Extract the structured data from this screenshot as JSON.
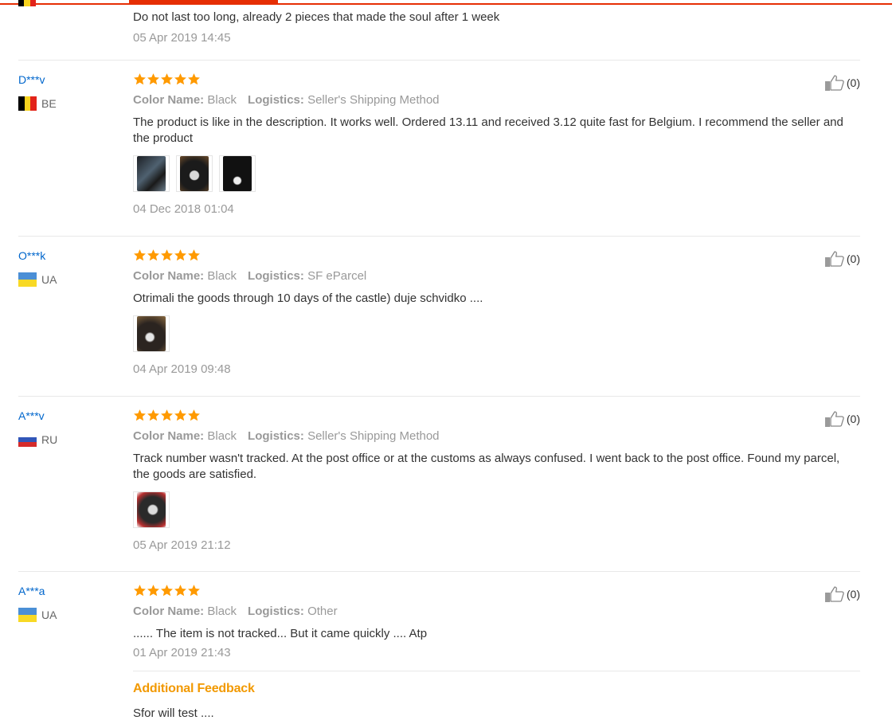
{
  "previous_review": {
    "text": "Do not last too long, already 2 pieces that made the soul after 1 week",
    "date": "05 Apr 2019 14:45"
  },
  "labels": {
    "color_name": "Color Name:",
    "logistics": "Logistics:"
  },
  "reviews": [
    {
      "user": "D***v",
      "country": "BE",
      "flag_colors": [
        "#000000",
        "#f7d21e",
        "#e2231a"
      ],
      "rating": 5,
      "color": "Black",
      "logistics": "Seller's Shipping Method",
      "text": "The product is like in the description. It works well. Ordered 13.11 and received 3.12 quite fast for Belgium. I recommend the seller and the product",
      "photo_count": 3,
      "date": "04 Dec 2018 01:04",
      "helpful": "(0)"
    },
    {
      "user": "O***k",
      "country": "UA",
      "flag_colors": [
        "#4b8fd6",
        "#f8d925"
      ],
      "rating": 5,
      "color": "Black",
      "logistics": "SF eParcel",
      "text": "Otrimali the goods through 10 days of the castle) duje schvidko ....",
      "photo_count": 1,
      "date": "04 Apr 2019 09:48",
      "helpful": "(0)"
    },
    {
      "user": "A***v",
      "country": "RU",
      "flag_colors": [
        "#ffffff",
        "#3156b8",
        "#d52b2b"
      ],
      "rating": 5,
      "color": "Black",
      "logistics": "Seller's Shipping Method",
      "text": "Track number wasn't tracked. At the post office or at the customs as always confused. I went back to the post office. Found my parcel, the goods are satisfied.",
      "photo_count": 1,
      "date": "05 Apr 2019 21:12",
      "helpful": "(0)"
    },
    {
      "user": "A***a",
      "country": "UA",
      "flag_colors": [
        "#4b8fd6",
        "#f8d925"
      ],
      "rating": 5,
      "color": "Black",
      "logistics": "Other",
      "text": "...... The item is not tracked... But it came quickly .... Atp",
      "photo_count": 0,
      "date": "01 Apr 2019 21:43",
      "helpful": "(0)",
      "additional_feedback": {
        "title": "Additional Feedback",
        "text": "Sfor will test ...."
      }
    }
  ],
  "colors": {
    "accent": "#e62e04",
    "star": "#ff9a00",
    "link": "#0066cc",
    "additional": "#f29900"
  }
}
